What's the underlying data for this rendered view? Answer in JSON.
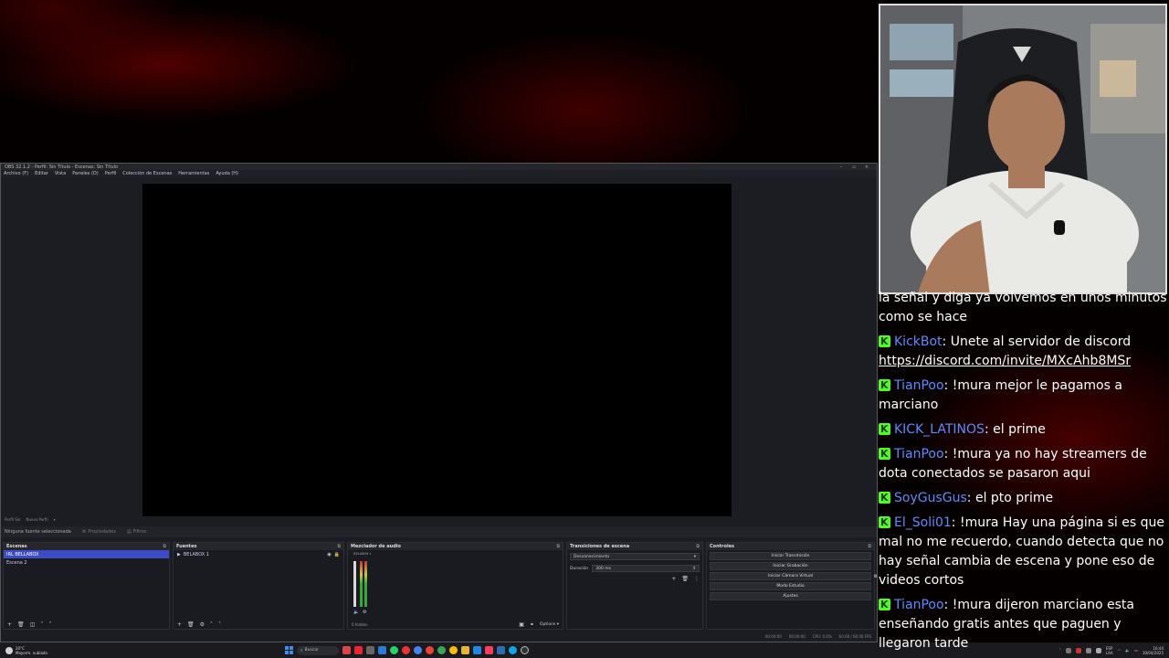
{
  "obs": {
    "title": "OBS 32.1.2 - Perfil: Sin Título - Escenas: Sin Título",
    "menu": [
      "Archivo (F)",
      "Editar",
      "Vista",
      "Paneles (D)",
      "Perfil",
      "Colección de Escenas",
      "Herramientas",
      "Ayuda (H)"
    ],
    "scene_tabs": [
      "Perfil Sin",
      "Nuevo Perfil"
    ],
    "source_bar": {
      "no_source": "Ninguna fuente seleccionada",
      "properties": "Propiedades",
      "filters": "Filtros"
    },
    "docks": {
      "scenes": {
        "title": "Escenas",
        "items": [
          "IRL BELLABOX",
          "Escena 2"
        ],
        "selected": 0
      },
      "sources": {
        "title": "Fuentes",
        "items": [
          "BELABOX 1"
        ]
      },
      "mixer": {
        "title": "Mezclador de audio",
        "channel": "BELABOX 1",
        "hidden": "0 hidden",
        "options": "Options"
      },
      "transitions": {
        "title": "Transiciones de escena",
        "type": "Desvanecimiento",
        "duration_label": "Duración",
        "duration_value": "300 ms"
      },
      "controls": {
        "title": "Controles",
        "buttons": [
          "Iniciar Transmisión",
          "Iniciar Grabación",
          "Iniciar Cámara Virtual",
          "Modo Estudio",
          "Ajustes"
        ]
      }
    },
    "status": {
      "stream_time": "00:00:00",
      "rec_time": "00:00:00",
      "cpu": "CPU: 0.0%",
      "fps": "60.00 / 60.00 FPS"
    }
  },
  "taskbar": {
    "weather_temp": "20°C",
    "weather_desc": "Mayorm. nublado",
    "search_placeholder": "Buscar",
    "lang_top": "ESP",
    "lang_bottom": "LAA",
    "time": "16:44",
    "date": "30/04/2025"
  },
  "chat": {
    "messages": [
      {
        "user": "",
        "text": "la señal y diga ya volvemos en unos minutos como se hace",
        "first": true
      },
      {
        "user": "KickBot",
        "color": "#5a8cff",
        "text": "Unete al servidor de discord ",
        "link": "https://discord.com/invite/MXcAhb8MSr"
      },
      {
        "user": "TianPoo",
        "color": "#5a8cff",
        "text": "!mura mejor le pagamos a marciano"
      },
      {
        "user": "KICK_LATINOS",
        "color": "#5a8cff",
        "text": "el prime"
      },
      {
        "user": "TianPoo",
        "color": "#5a8cff",
        "text": "!mura ya no hay streamers de dota conectados se pasaron aqui"
      },
      {
        "user": "SoyGusGus",
        "color": "#5a8cff",
        "text": "el pto prime"
      },
      {
        "user": "El_Soli01",
        "color": "#5a8cff",
        "text": "!mura Hay una página si es que mal no me recuerdo, cuando detecta que no hay señal cambia de escena y pone eso de videos cortos"
      },
      {
        "user": "TianPoo",
        "color": "#5a8cff",
        "text": "!mura dijeron marciano esta enseñando gratis antes que paguen y llegaron tarde"
      }
    ]
  },
  "colors": {
    "accent_selected": "#3c4cc6",
    "kick_green": "#53fc18",
    "username_blue": "#5a8cff"
  }
}
